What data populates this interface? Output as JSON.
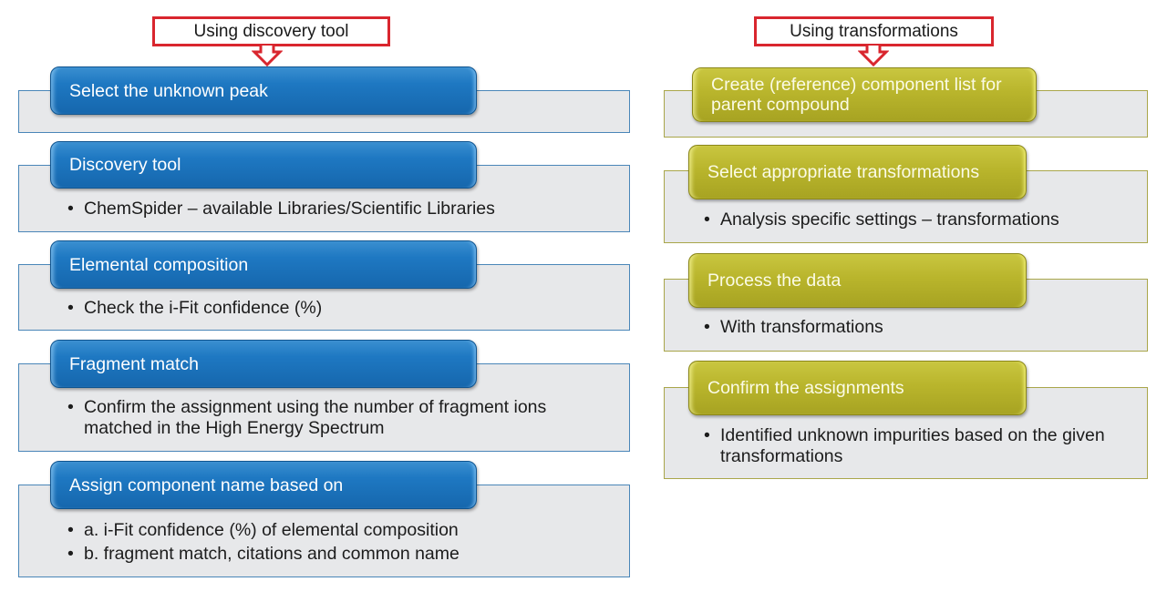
{
  "left_column": {
    "callout": {
      "label": "Using discovery tool",
      "icon": "down-arrow-icon"
    },
    "accent_color": "#1e78c2",
    "steps": [
      {
        "title": "Select the unknown peak",
        "bullets": []
      },
      {
        "title": "Discovery tool",
        "bullets": [
          "ChemSpider – available Libraries/Scientific Libraries"
        ]
      },
      {
        "title": "Elemental composition",
        "bullets": [
          "Check the i-Fit confidence (%)"
        ]
      },
      {
        "title": "Fragment match",
        "bullets": [
          "Confirm the assignment using the number of fragment ions matched in the High Energy Spectrum"
        ]
      },
      {
        "title": "Assign component name based on",
        "bullets": [
          "a. i-Fit confidence (%) of elemental composition",
          "b. fragment match, citations and common name"
        ]
      }
    ]
  },
  "right_column": {
    "callout": {
      "label": "Using transformations",
      "icon": "down-arrow-icon"
    },
    "accent_color": "#b9b52c",
    "steps": [
      {
        "title": "Create (reference) component list for parent compound",
        "bullets": []
      },
      {
        "title": "Select appropriate transformations",
        "bullets": [
          "Analysis specific settings – transformations"
        ]
      },
      {
        "title": "Process the data",
        "bullets": [
          "With transformations"
        ]
      },
      {
        "title": "Confirm the assignments",
        "bullets": [
          "Identified unknown impurities based on the given transformations"
        ]
      }
    ]
  },
  "callout_color": "#d9262e",
  "bullet_glyph": "•"
}
